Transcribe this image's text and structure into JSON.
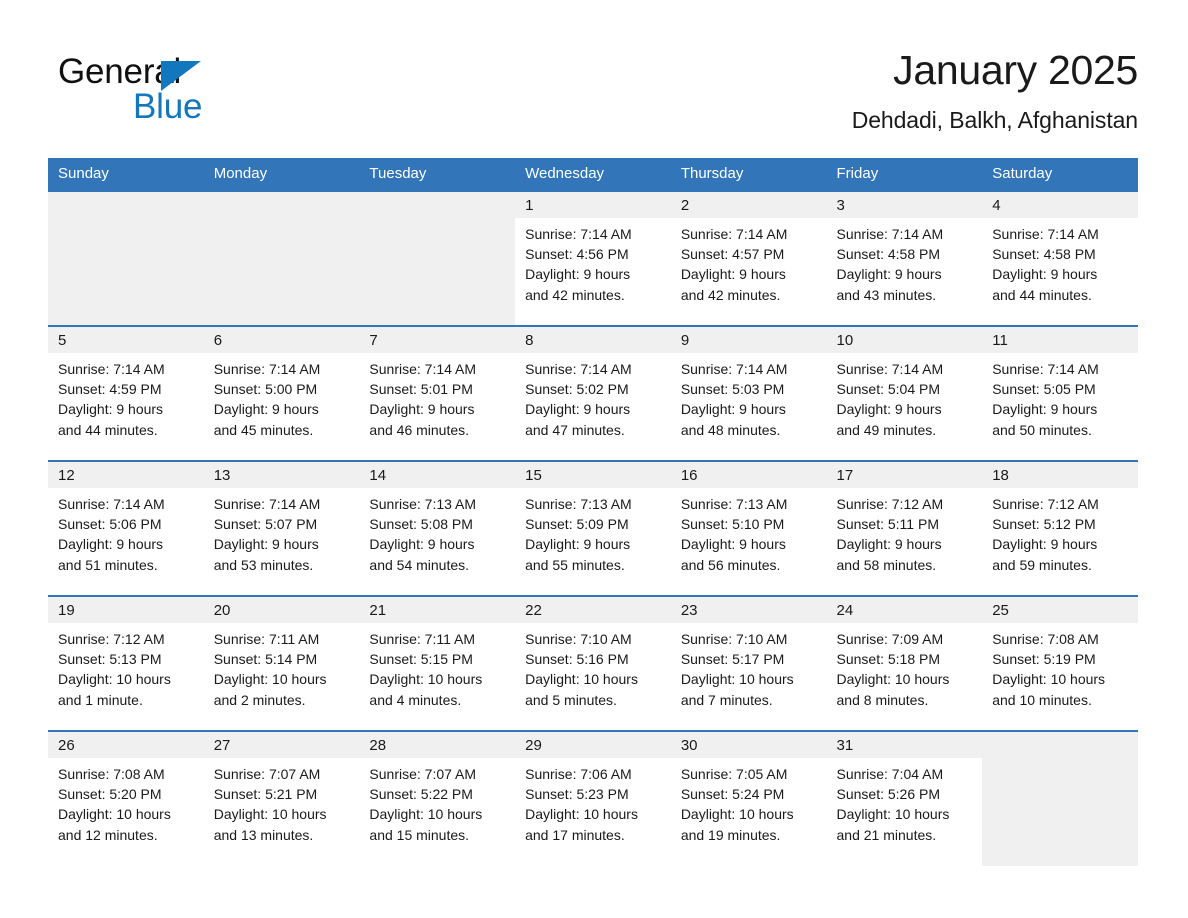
{
  "brand": {
    "name_part1": "General",
    "name_part2": "Blue",
    "color_black": "#101010",
    "color_blue": "#1277bc"
  },
  "header": {
    "month_title": "January 2025",
    "location": "Dehdadi, Balkh, Afghanistan"
  },
  "theme": {
    "header_blue": "#3275b8",
    "band_gray": "#f0f0f0",
    "text_color": "#1a1a1a"
  },
  "weekday_headers": [
    "Sunday",
    "Monday",
    "Tuesday",
    "Wednesday",
    "Thursday",
    "Friday",
    "Saturday"
  ],
  "weeks": [
    [
      {
        "day": "",
        "lines": []
      },
      {
        "day": "",
        "lines": []
      },
      {
        "day": "",
        "lines": []
      },
      {
        "day": "1",
        "lines": [
          "Sunrise: 7:14 AM",
          "Sunset: 4:56 PM",
          "Daylight: 9 hours",
          "and 42 minutes."
        ]
      },
      {
        "day": "2",
        "lines": [
          "Sunrise: 7:14 AM",
          "Sunset: 4:57 PM",
          "Daylight: 9 hours",
          "and 42 minutes."
        ]
      },
      {
        "day": "3",
        "lines": [
          "Sunrise: 7:14 AM",
          "Sunset: 4:58 PM",
          "Daylight: 9 hours",
          "and 43 minutes."
        ]
      },
      {
        "day": "4",
        "lines": [
          "Sunrise: 7:14 AM",
          "Sunset: 4:58 PM",
          "Daylight: 9 hours",
          "and 44 minutes."
        ]
      }
    ],
    [
      {
        "day": "5",
        "lines": [
          "Sunrise: 7:14 AM",
          "Sunset: 4:59 PM",
          "Daylight: 9 hours",
          "and 44 minutes."
        ]
      },
      {
        "day": "6",
        "lines": [
          "Sunrise: 7:14 AM",
          "Sunset: 5:00 PM",
          "Daylight: 9 hours",
          "and 45 minutes."
        ]
      },
      {
        "day": "7",
        "lines": [
          "Sunrise: 7:14 AM",
          "Sunset: 5:01 PM",
          "Daylight: 9 hours",
          "and 46 minutes."
        ]
      },
      {
        "day": "8",
        "lines": [
          "Sunrise: 7:14 AM",
          "Sunset: 5:02 PM",
          "Daylight: 9 hours",
          "and 47 minutes."
        ]
      },
      {
        "day": "9",
        "lines": [
          "Sunrise: 7:14 AM",
          "Sunset: 5:03 PM",
          "Daylight: 9 hours",
          "and 48 minutes."
        ]
      },
      {
        "day": "10",
        "lines": [
          "Sunrise: 7:14 AM",
          "Sunset: 5:04 PM",
          "Daylight: 9 hours",
          "and 49 minutes."
        ]
      },
      {
        "day": "11",
        "lines": [
          "Sunrise: 7:14 AM",
          "Sunset: 5:05 PM",
          "Daylight: 9 hours",
          "and 50 minutes."
        ]
      }
    ],
    [
      {
        "day": "12",
        "lines": [
          "Sunrise: 7:14 AM",
          "Sunset: 5:06 PM",
          "Daylight: 9 hours",
          "and 51 minutes."
        ]
      },
      {
        "day": "13",
        "lines": [
          "Sunrise: 7:14 AM",
          "Sunset: 5:07 PM",
          "Daylight: 9 hours",
          "and 53 minutes."
        ]
      },
      {
        "day": "14",
        "lines": [
          "Sunrise: 7:13 AM",
          "Sunset: 5:08 PM",
          "Daylight: 9 hours",
          "and 54 minutes."
        ]
      },
      {
        "day": "15",
        "lines": [
          "Sunrise: 7:13 AM",
          "Sunset: 5:09 PM",
          "Daylight: 9 hours",
          "and 55 minutes."
        ]
      },
      {
        "day": "16",
        "lines": [
          "Sunrise: 7:13 AM",
          "Sunset: 5:10 PM",
          "Daylight: 9 hours",
          "and 56 minutes."
        ]
      },
      {
        "day": "17",
        "lines": [
          "Sunrise: 7:12 AM",
          "Sunset: 5:11 PM",
          "Daylight: 9 hours",
          "and 58 minutes."
        ]
      },
      {
        "day": "18",
        "lines": [
          "Sunrise: 7:12 AM",
          "Sunset: 5:12 PM",
          "Daylight: 9 hours",
          "and 59 minutes."
        ]
      }
    ],
    [
      {
        "day": "19",
        "lines": [
          "Sunrise: 7:12 AM",
          "Sunset: 5:13 PM",
          "Daylight: 10 hours",
          "and 1 minute."
        ]
      },
      {
        "day": "20",
        "lines": [
          "Sunrise: 7:11 AM",
          "Sunset: 5:14 PM",
          "Daylight: 10 hours",
          "and 2 minutes."
        ]
      },
      {
        "day": "21",
        "lines": [
          "Sunrise: 7:11 AM",
          "Sunset: 5:15 PM",
          "Daylight: 10 hours",
          "and 4 minutes."
        ]
      },
      {
        "day": "22",
        "lines": [
          "Sunrise: 7:10 AM",
          "Sunset: 5:16 PM",
          "Daylight: 10 hours",
          "and 5 minutes."
        ]
      },
      {
        "day": "23",
        "lines": [
          "Sunrise: 7:10 AM",
          "Sunset: 5:17 PM",
          "Daylight: 10 hours",
          "and 7 minutes."
        ]
      },
      {
        "day": "24",
        "lines": [
          "Sunrise: 7:09 AM",
          "Sunset: 5:18 PM",
          "Daylight: 10 hours",
          "and 8 minutes."
        ]
      },
      {
        "day": "25",
        "lines": [
          "Sunrise: 7:08 AM",
          "Sunset: 5:19 PM",
          "Daylight: 10 hours",
          "and 10 minutes."
        ]
      }
    ],
    [
      {
        "day": "26",
        "lines": [
          "Sunrise: 7:08 AM",
          "Sunset: 5:20 PM",
          "Daylight: 10 hours",
          "and 12 minutes."
        ]
      },
      {
        "day": "27",
        "lines": [
          "Sunrise: 7:07 AM",
          "Sunset: 5:21 PM",
          "Daylight: 10 hours",
          "and 13 minutes."
        ]
      },
      {
        "day": "28",
        "lines": [
          "Sunrise: 7:07 AM",
          "Sunset: 5:22 PM",
          "Daylight: 10 hours",
          "and 15 minutes."
        ]
      },
      {
        "day": "29",
        "lines": [
          "Sunrise: 7:06 AM",
          "Sunset: 5:23 PM",
          "Daylight: 10 hours",
          "and 17 minutes."
        ]
      },
      {
        "day": "30",
        "lines": [
          "Sunrise: 7:05 AM",
          "Sunset: 5:24 PM",
          "Daylight: 10 hours",
          "and 19 minutes."
        ]
      },
      {
        "day": "31",
        "lines": [
          "Sunrise: 7:04 AM",
          "Sunset: 5:26 PM",
          "Daylight: 10 hours",
          "and 21 minutes."
        ]
      },
      {
        "day": "",
        "lines": []
      }
    ]
  ]
}
